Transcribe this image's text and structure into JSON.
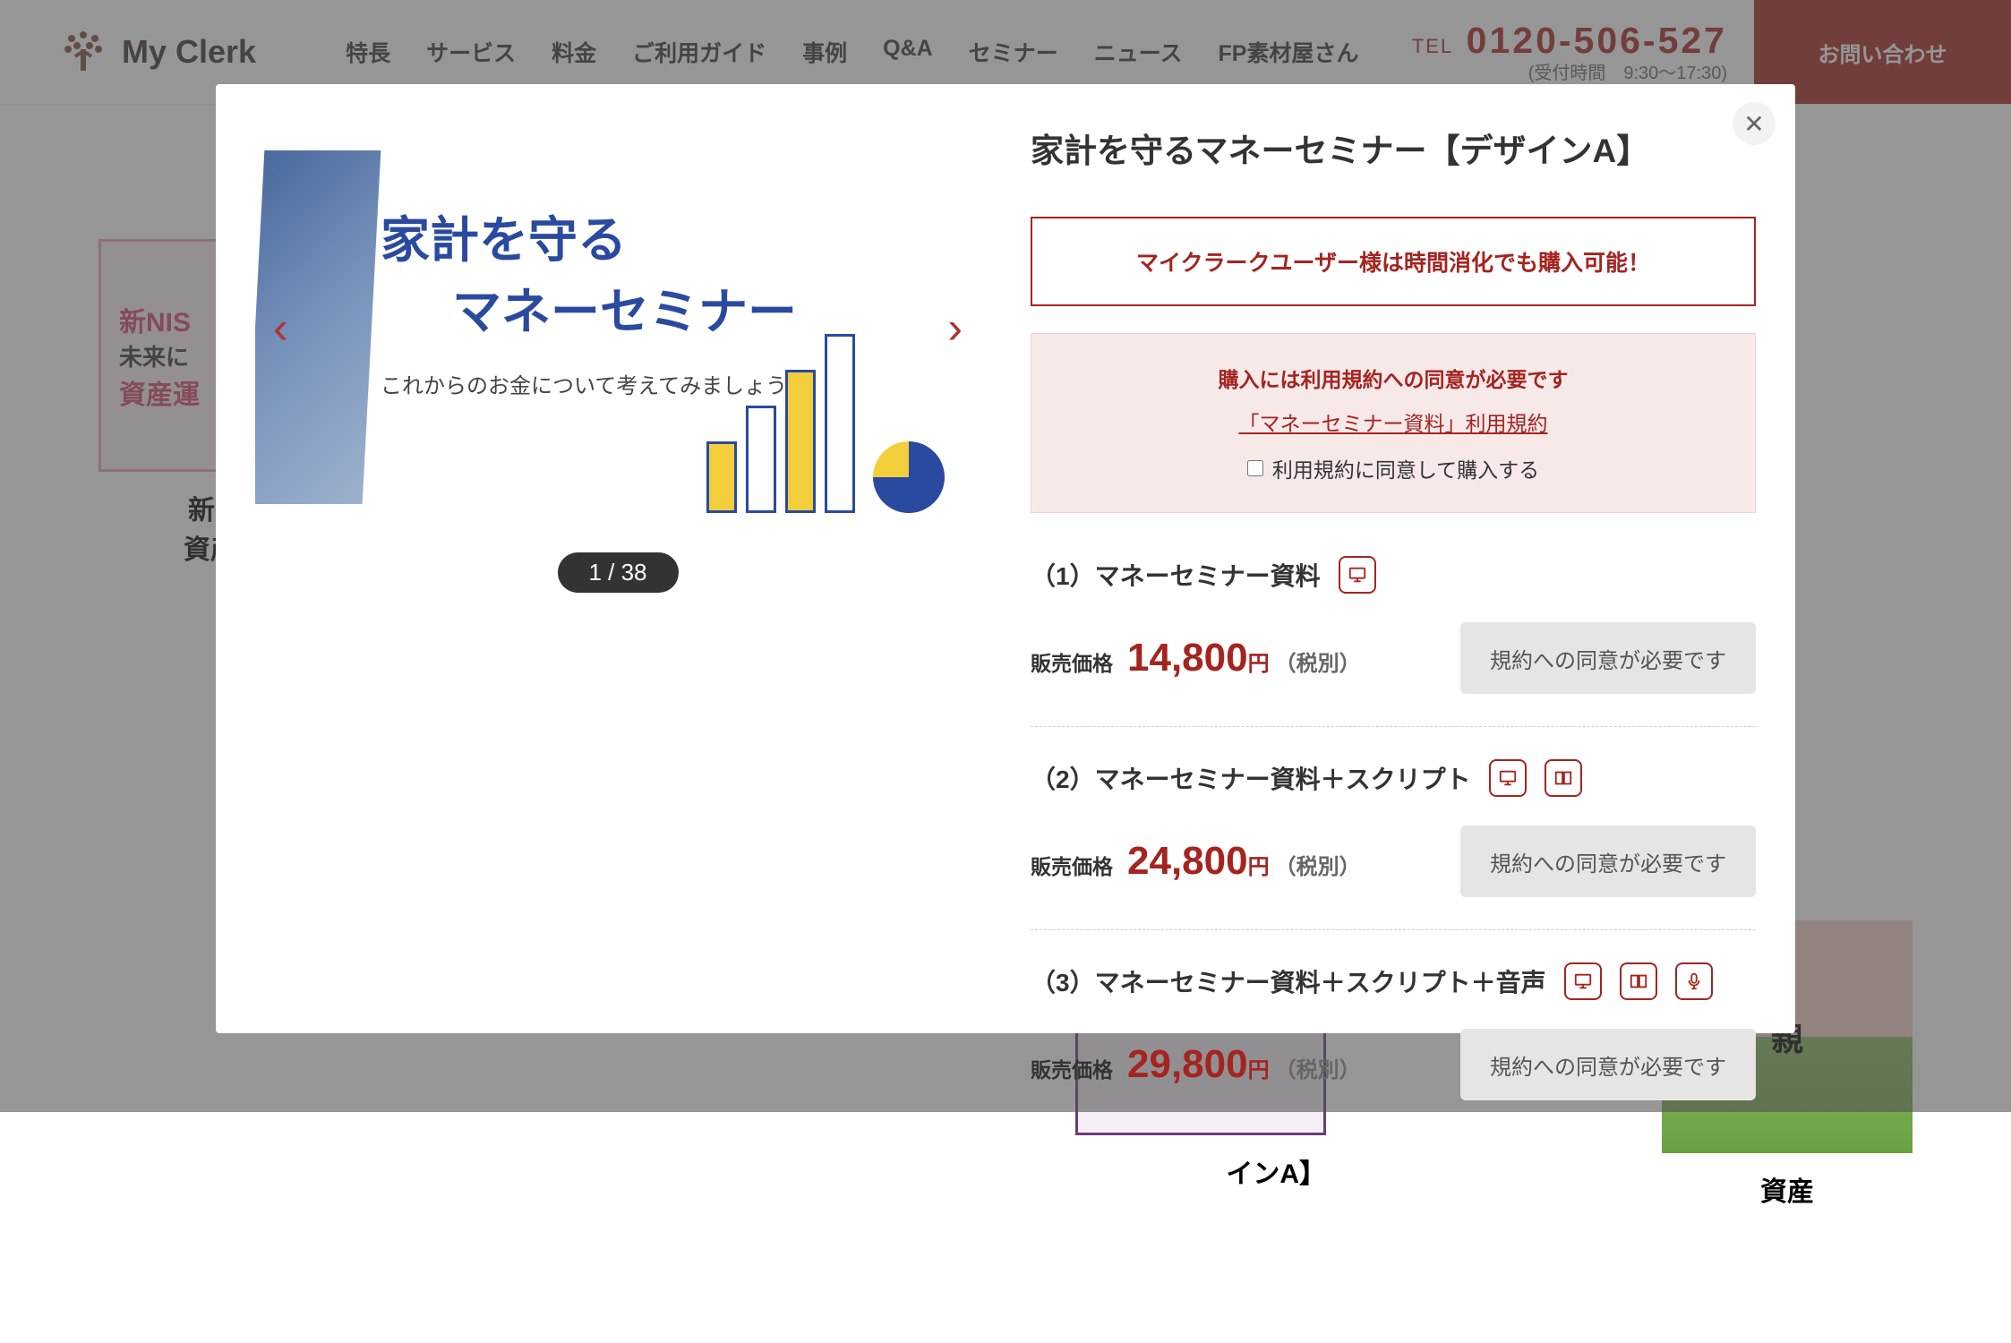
{
  "header": {
    "brand": "My Clerk",
    "nav": [
      "特長",
      "サービス",
      "料金",
      "ご利用ガイド",
      "事例",
      "Q&A",
      "セミナー",
      "ニュース",
      "FP素材屋さん"
    ],
    "tel_label": "TEL",
    "tel_number": "0120-506-527",
    "tel_hours": "(受付時間　9:30〜17:30)",
    "contact": "お問い合わせ"
  },
  "bg_cards": {
    "card1_line1": "新NIS",
    "card1_line2": "未来に",
    "card1_line3": "資産運",
    "card1_title_a": "新NIS",
    "card1_title_b": "資産運",
    "card2_suffix": "インA】",
    "card3_line": "親",
    "card3_title": "資産"
  },
  "modal": {
    "title": "家計を守るマネーセミナー【デザインA】",
    "slide": {
      "line1": "家計を守る",
      "line2": "マネーセミナー",
      "caption": "これからのお金について考えてみましょう",
      "pager": "1 / 38"
    },
    "notice": "マイクラークユーザー様は時間消化でも購入可能！",
    "terms": {
      "line1": "購入には利用規約への同意が必要です",
      "link": "「マネーセミナー資料」利用規約",
      "check_label": "利用規約に同意して購入する"
    },
    "price_label": "販売価格",
    "price_yen": "円",
    "price_tax": "（税別）",
    "products": [
      {
        "name": "（1）マネーセミナー資料",
        "price": "14,800",
        "btn": "規約への同意が必要です",
        "icons": [
          "presentation"
        ]
      },
      {
        "name": "（2）マネーセミナー資料＋スクリプト",
        "price": "24,800",
        "btn": "規約への同意が必要です",
        "icons": [
          "presentation",
          "book"
        ]
      },
      {
        "name": "（3）マネーセミナー資料＋スクリプト＋音声",
        "price": "29,800",
        "btn": "規約への同意が必要です",
        "icons": [
          "presentation",
          "book",
          "mic"
        ]
      }
    ]
  }
}
